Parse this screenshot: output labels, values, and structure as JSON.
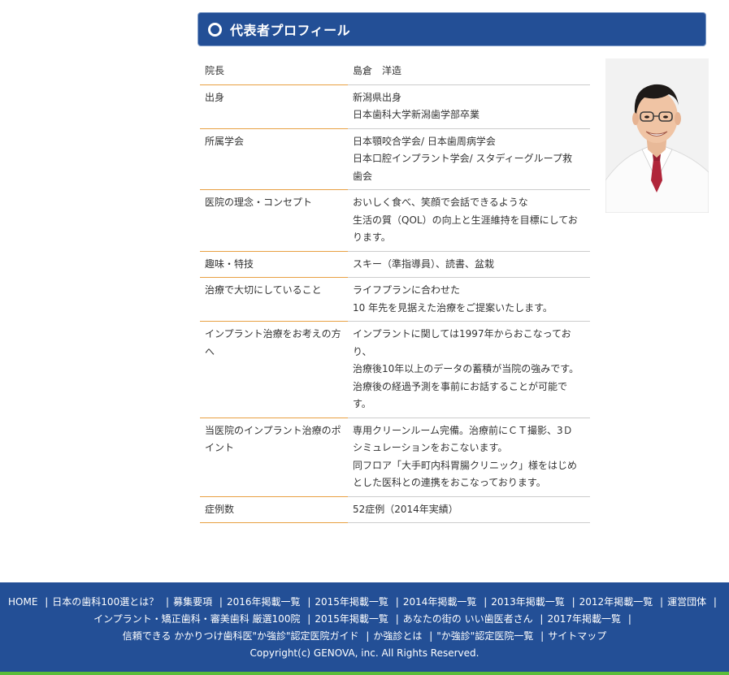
{
  "section": {
    "title": "代表者プロフィール"
  },
  "profile": {
    "rows": [
      {
        "label": "院長",
        "lines": [
          "島倉　洋造"
        ]
      },
      {
        "label": "出身",
        "lines": [
          "新潟県出身",
          "日本歯科大学新潟歯学部卒業"
        ]
      },
      {
        "label": "所属学会",
        "lines": [
          "日本顎咬合学会/ 日本歯周病学会",
          "日本口腔インプラント学会/ スタディーグループ救",
          "歯会"
        ]
      },
      {
        "label": "医院の理念・コンセプト",
        "lines": [
          "おいしく食べ、笑顔で会話できるような",
          "生活の質（QOL）の向上と生涯維持を目標にしてお",
          "ります。"
        ]
      },
      {
        "label": "趣味・特技",
        "lines": [
          "スキー（準指導員）、読書、盆栽"
        ]
      },
      {
        "label": "治療で大切にしていること",
        "lines": [
          "ライフプランに合わせた",
          "10 年先を見据えた治療をご提案いたします。"
        ]
      },
      {
        "label": "インプラント治療をお考えの方へ",
        "lines": [
          "インプラントに関しては1997年からおこなってお",
          "り、",
          "治療後10年以上のデータの蓄積が当院の強みです。",
          "治療後の経過予測を事前にお話することが可能で",
          "す。"
        ]
      },
      {
        "label": "当医院のインプラント治療のポイント",
        "lines": [
          "専用クリーンルーム完備。治療前にＣＴ撮影、3Ｄ",
          "シミュレーションをおこないます。",
          "同フロア「大手町内科胃腸クリニック」様をはじめ",
          "とした医科との連携をおこなっております。"
        ]
      },
      {
        "label": "症例数",
        "lines": [
          "52症例（2014年実績）"
        ]
      }
    ]
  },
  "footer": {
    "links": [
      "HOME",
      "日本の歯科100選とは？",
      "募集要項",
      "2016年掲載一覧",
      "2015年掲載一覧",
      "2014年掲載一覧",
      "2013年掲載一覧",
      "2012年掲載一覧",
      "運営団体",
      "インプラント・矯正歯科・審美歯科 厳選100院",
      "2015年掲載一覧",
      "あなたの街の いい歯医者さん",
      "2017年掲載一覧",
      "信頼できる かかりつけ歯科医\"か強診\"認定医院ガイド",
      "か強診とは",
      "\"か強診\"認定医院一覧",
      "サイトマップ"
    ],
    "copyright": "Copyright(c) GENOVA, inc. All Rights Reserved."
  },
  "colors": {
    "header_blue": "#234f96",
    "divider_orange": "#e8a042",
    "footer_green": "#5bbd3a"
  }
}
